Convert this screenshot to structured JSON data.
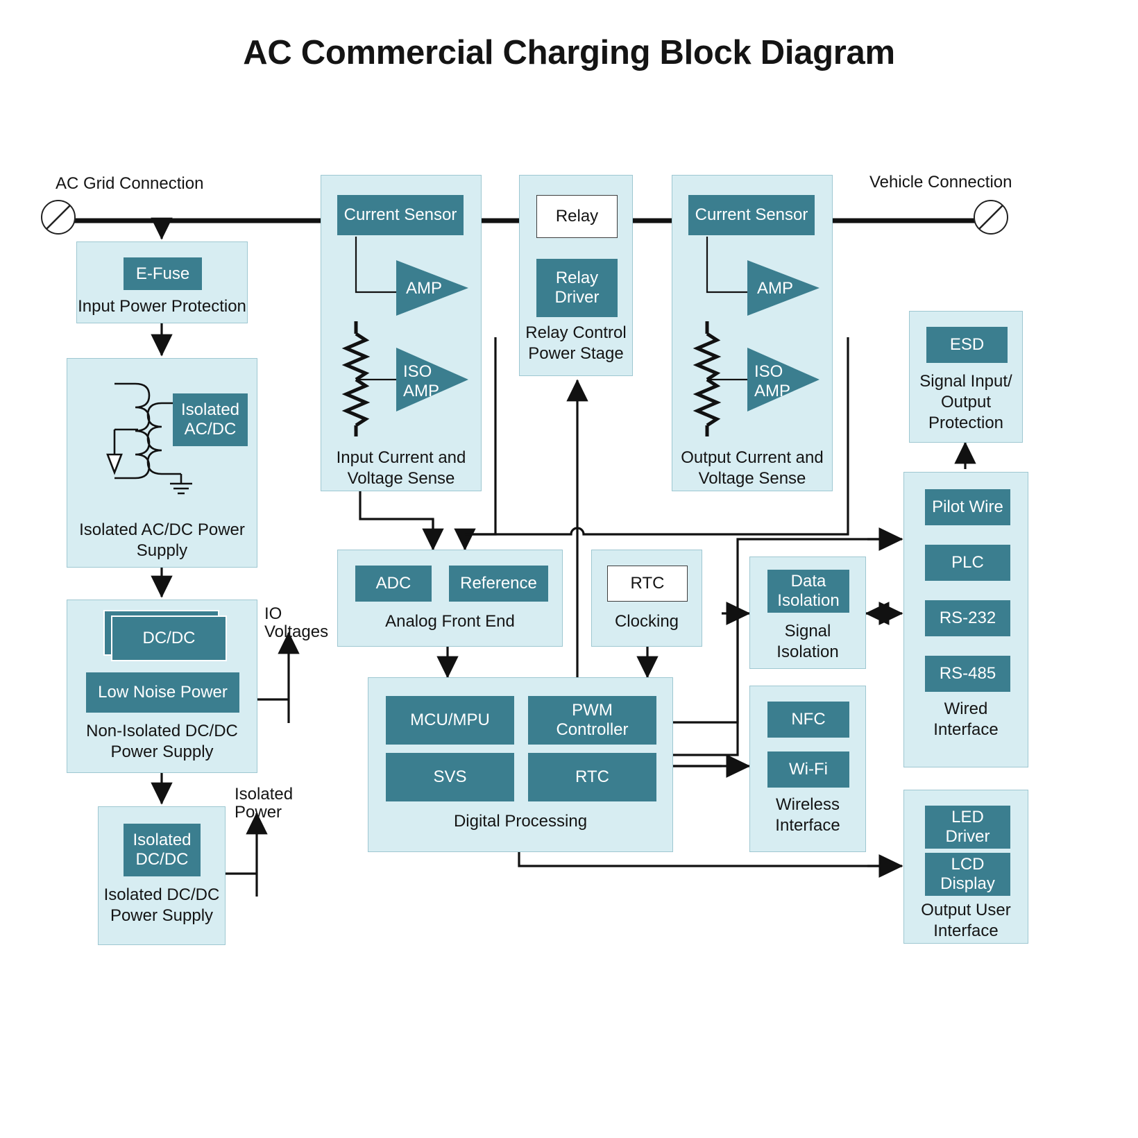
{
  "title": "AC Commercial Charging Block Diagram",
  "endpoints": {
    "grid_label": "AC Grid Connection",
    "vehicle_label": "Vehicle Connection",
    "connector_icon": "circle-slash-connector-icon"
  },
  "rail_labels": {
    "io_voltages": "IO\nVoltages",
    "io_voltages_line1": "IO",
    "io_voltages_line2": "Voltages",
    "isolated_power_line1": "Isolated",
    "isolated_power_line2": "Power"
  },
  "blocks": [
    {
      "id": "input-power-protection",
      "caption": "Input Power Protection",
      "chips": [
        {
          "label": "E-Fuse",
          "style": "teal"
        }
      ]
    },
    {
      "id": "isolated-acdc-power-supply",
      "caption": "Isolated AC/DC Power\nSupply",
      "caption_line1": "Isolated AC/DC Power",
      "caption_line2": "Supply",
      "chips": [
        {
          "label": "Isolated\nAC/DC",
          "style": "teal"
        }
      ],
      "symbols": [
        "transformer-symbol",
        "ground-symbol",
        "arrow-symbol"
      ]
    },
    {
      "id": "non-isolated-dcdc-power-supply",
      "caption": "Non-Isolated DC/DC\nPower Supply",
      "caption_line1": "Non-Isolated DC/DC",
      "caption_line2": "Power Supply",
      "chips": [
        {
          "label": "DC/DC",
          "style": "teal-stacked"
        },
        {
          "label": "Low Noise Power",
          "style": "teal"
        }
      ]
    },
    {
      "id": "isolated-dcdc-power-supply",
      "caption": "Isolated DC/DC\nPower Supply",
      "caption_line1": "Isolated DC/DC",
      "caption_line2": "Power Supply",
      "chips": [
        {
          "label": "Isolated\nDC/DC",
          "style": "teal"
        }
      ]
    },
    {
      "id": "input-current-voltage-sense",
      "caption": "Input Current and\nVoltage Sense",
      "caption_line1": "Input Current and",
      "caption_line2": "Voltage Sense",
      "chips": [
        {
          "label": "Current Sensor",
          "style": "teal"
        },
        {
          "label": "AMP",
          "style": "teal-triangle"
        },
        {
          "label": "ISO\nAMP",
          "style": "teal-triangle"
        }
      ],
      "symbols": [
        "resistor-divider-symbol"
      ]
    },
    {
      "id": "relay-control-power-stage",
      "caption": "Relay Control\nPower Stage",
      "caption_line1": "Relay Control",
      "caption_line2": "Power Stage",
      "chips": [
        {
          "label": "Relay",
          "style": "white"
        },
        {
          "label": "Relay\nDriver",
          "style": "teal"
        }
      ]
    },
    {
      "id": "output-current-voltage-sense",
      "caption": "Output Current and\nVoltage Sense",
      "caption_line1": "Output Current and",
      "caption_line2": "Voltage Sense",
      "chips": [
        {
          "label": "Current Sensor",
          "style": "teal"
        },
        {
          "label": "AMP",
          "style": "teal-triangle"
        },
        {
          "label": "ISO\nAMP",
          "style": "teal-triangle"
        }
      ],
      "symbols": [
        "resistor-divider-symbol"
      ]
    },
    {
      "id": "analog-front-end",
      "caption": "Analog Front End",
      "chips": [
        {
          "label": "ADC",
          "style": "teal"
        },
        {
          "label": "Reference",
          "style": "teal"
        }
      ]
    },
    {
      "id": "clocking",
      "caption": "Clocking",
      "chips": [
        {
          "label": "RTC",
          "style": "white"
        }
      ]
    },
    {
      "id": "digital-processing",
      "caption": "Digital Processing",
      "chips": [
        {
          "label": "MCU/MPU",
          "style": "teal"
        },
        {
          "label": "PWM\nController",
          "style": "teal"
        },
        {
          "label": "SVS",
          "style": "teal"
        },
        {
          "label": "RTC",
          "style": "teal"
        }
      ]
    },
    {
      "id": "signal-isolation",
      "caption": "Signal\nIsolation",
      "caption_line1": "Signal",
      "caption_line2": "Isolation",
      "chips": [
        {
          "label": "Data\nIsolation",
          "style": "teal"
        }
      ]
    },
    {
      "id": "wireless-interface",
      "caption": "Wireless\nInterface",
      "caption_line1": "Wireless",
      "caption_line2": "Interface",
      "chips": [
        {
          "label": "NFC",
          "style": "teal"
        },
        {
          "label": "Wi-Fi",
          "style": "teal"
        }
      ]
    },
    {
      "id": "signal-io-protection",
      "caption": "Signal Input/\nOutput\nProtection",
      "caption_line1": "Signal Input/",
      "caption_line2": "Output",
      "caption_line3": "Protection",
      "chips": [
        {
          "label": "ESD",
          "style": "teal"
        }
      ]
    },
    {
      "id": "wired-interface",
      "caption": "Wired\nInterface",
      "caption_line1": "Wired",
      "caption_line2": "Interface",
      "chips": [
        {
          "label": "Pilot Wire",
          "style": "teal"
        },
        {
          "label": "PLC",
          "style": "teal"
        },
        {
          "label": "RS-232",
          "style": "teal"
        },
        {
          "label": "RS-485",
          "style": "teal"
        }
      ]
    },
    {
      "id": "output-user-interface",
      "caption": "Output User\nInterface",
      "caption_line1": "Output User",
      "caption_line2": "Interface",
      "chips": [
        {
          "label": "LED\nDriver",
          "style": "teal"
        },
        {
          "label": "LCD\nDisplay",
          "style": "teal"
        }
      ]
    }
  ],
  "text": {
    "e_fuse": "E-Fuse",
    "input_power_protection": "Input Power Protection",
    "isolated_acdc_l1": "Isolated",
    "isolated_acdc_l2": "AC/DC",
    "isolated_acdc_cap_l1": "Isolated AC/DC Power",
    "isolated_acdc_cap_l2": "Supply",
    "dcdc": "DC/DC",
    "low_noise_power": "Low Noise Power",
    "non_iso_cap_l1": "Non-Isolated DC/DC",
    "non_iso_cap_l2": "Power Supply",
    "isolated_dcdc_l1": "Isolated",
    "isolated_dcdc_l2": "DC/DC",
    "isolated_dcdc_cap_l1": "Isolated DC/DC",
    "isolated_dcdc_cap_l2": "Power Supply",
    "current_sensor": "Current Sensor",
    "amp": "AMP",
    "iso_l1": "ISO",
    "iso_l2": "AMP",
    "input_sense_cap_l1": "Input Current and",
    "input_sense_cap_l2": "Voltage Sense",
    "relay": "Relay",
    "relay_driver_l1": "Relay",
    "relay_driver_l2": "Driver",
    "relay_cap_l1": "Relay Control",
    "relay_cap_l2": "Power Stage",
    "output_sense_cap_l1": "Output Current and",
    "output_sense_cap_l2": "Voltage Sense",
    "adc": "ADC",
    "reference": "Reference",
    "afe_cap": "Analog Front End",
    "rtc": "RTC",
    "clocking_cap": "Clocking",
    "mcu_mpu": "MCU/MPU",
    "pwm_l1": "PWM",
    "pwm_l2": "Controller",
    "svs": "SVS",
    "digital_cap": "Digital Processing",
    "data_iso_l1": "Data",
    "data_iso_l2": "Isolation",
    "signal_iso_cap_l1": "Signal",
    "signal_iso_cap_l2": "Isolation",
    "nfc": "NFC",
    "wifi": "Wi-Fi",
    "wireless_cap_l1": "Wireless",
    "wireless_cap_l2": "Interface",
    "esd": "ESD",
    "esd_cap_l1": "Signal Input/",
    "esd_cap_l2": "Output",
    "esd_cap_l3": "Protection",
    "pilot_wire": "Pilot Wire",
    "plc": "PLC",
    "rs232": "RS-232",
    "rs485": "RS-485",
    "wired_cap_l1": "Wired",
    "wired_cap_l2": "Interface",
    "led_l1": "LED",
    "led_l2": "Driver",
    "lcd_l1": "LCD",
    "lcd_l2": "Display",
    "oui_cap_l1": "Output User",
    "oui_cap_l2": "Interface"
  },
  "colors": {
    "group_fill": "#d7edf2",
    "group_stroke": "#9ec7d1",
    "chip_fill": "#3b7e8f",
    "chip_text": "#ffffff",
    "wire": "#111111",
    "page_bg": "#ffffff"
  }
}
